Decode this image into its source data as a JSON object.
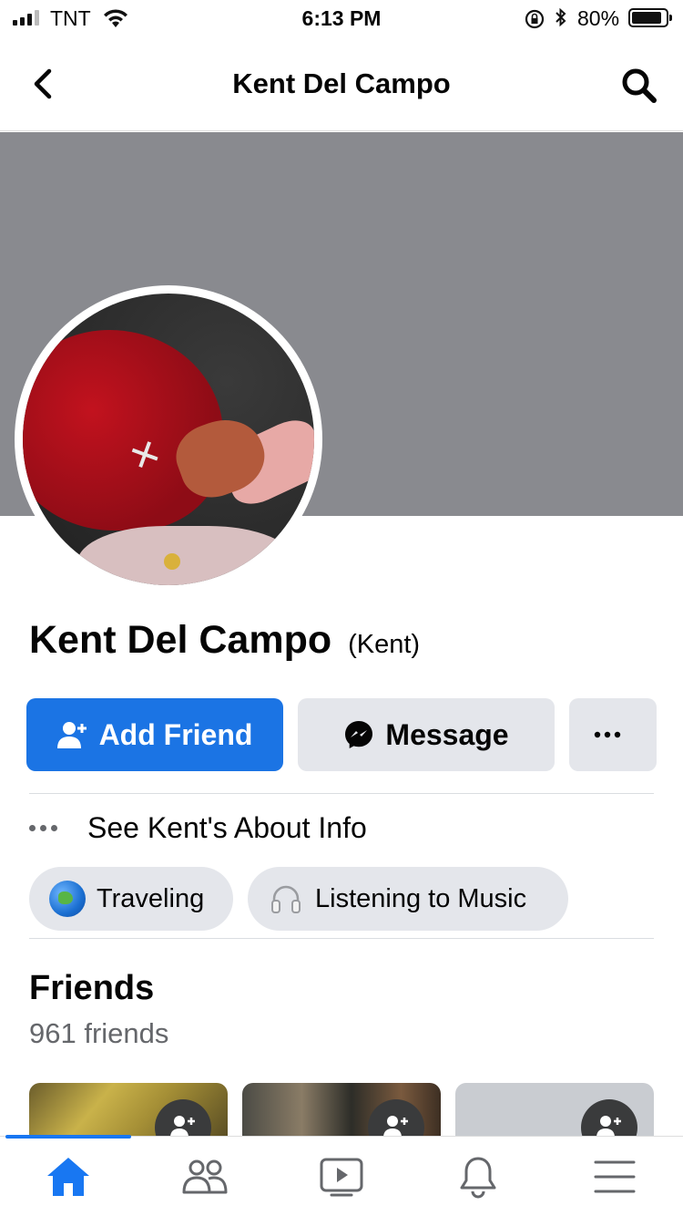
{
  "status_bar": {
    "carrier": "TNT",
    "time": "6:13 PM",
    "battery_percent": "80%",
    "battery_level": 0.8,
    "icons": [
      "signal-icon",
      "wifi-icon",
      "orientation-lock-icon",
      "bluetooth-icon",
      "battery-icon"
    ]
  },
  "navbar": {
    "title": "Kent Del Campo",
    "icons": [
      "back-chevron-icon",
      "search-icon"
    ]
  },
  "profile": {
    "name": "Kent Del Campo",
    "nickname": "(Kent)"
  },
  "actions": {
    "add_friend_label": "Add Friend",
    "message_label": "Message",
    "more_icon": "more-dots-icon",
    "accent_color": "#1b74e4"
  },
  "about": {
    "label": "See Kent's About Info"
  },
  "hobbies": [
    {
      "label": "Traveling",
      "icon": "globe-icon"
    },
    {
      "label": "Listening to Music",
      "icon": "headphones-icon"
    }
  ],
  "friends": {
    "title": "Friends",
    "count_label": "961 friends",
    "card_icon": "add-friend-icon"
  },
  "tabbar": {
    "active_tab": "home",
    "tabs": [
      "home-icon",
      "friends-icon",
      "watch-icon",
      "notifications-icon",
      "menu-icon"
    ]
  }
}
